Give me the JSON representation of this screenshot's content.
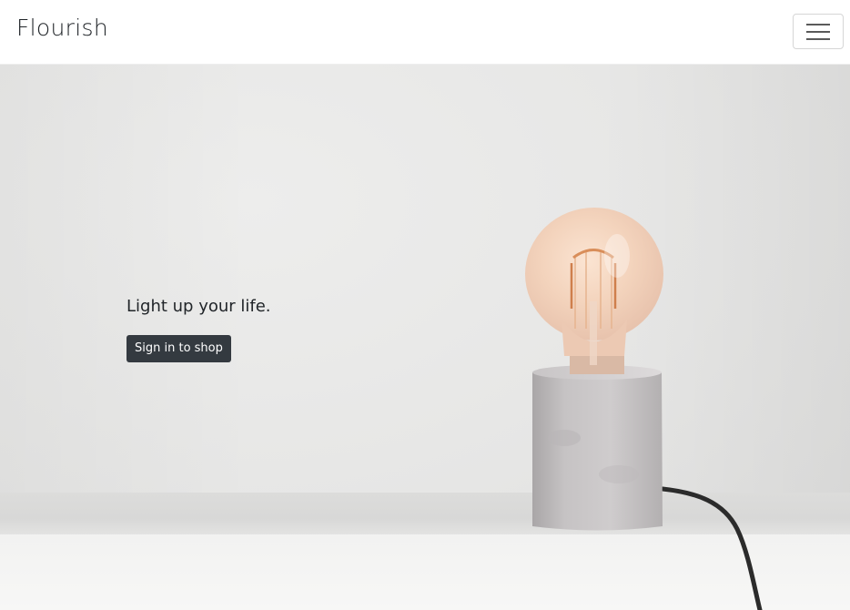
{
  "navbar": {
    "brand": "Flourish",
    "toggler_icon": "hamburger-menu-icon"
  },
  "hero": {
    "tagline": "Light up your life.",
    "cta_label": "Sign in to shop",
    "image": "lightbulb-lamp-photo"
  },
  "colors": {
    "button_bg": "#343a40",
    "text": "#212529",
    "navbar_bg": "#ffffff"
  }
}
